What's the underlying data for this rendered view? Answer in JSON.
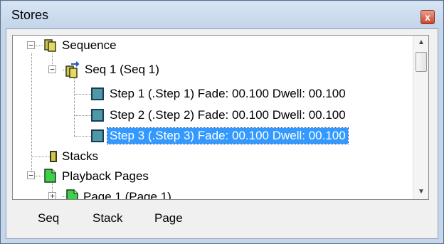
{
  "window": {
    "title": "Stores",
    "close_glyph": "x"
  },
  "tree": {
    "nodes": [
      {
        "label": "Sequence",
        "icon": "sequence-folder-icon"
      },
      {
        "label": "Seq 1 (Seq 1)",
        "icon": "sequence-item-icon"
      },
      {
        "label": "Step 1 (.Step 1) Fade: 00.100 Dwell: 00.100",
        "icon": "step-icon"
      },
      {
        "label": "Step 2 (.Step 2) Fade: 00.100 Dwell: 00.100",
        "icon": "step-icon"
      },
      {
        "label": "Step 3 (.Step 3) Fade: 00.100 Dwell: 00.100",
        "icon": "step-icon",
        "selected": true
      },
      {
        "label": "Stacks",
        "icon": "stacks-icon"
      },
      {
        "label": "Playback Pages",
        "icon": "page-icon"
      },
      {
        "label": "Page 1 (Page 1)",
        "icon": "page-icon"
      }
    ],
    "expander_collapse": "−",
    "expander_expand": "+"
  },
  "scrollbar": {
    "up_glyph": "▲",
    "down_glyph": "▼"
  },
  "buttons": {
    "seq": "Seq",
    "stack": "Stack",
    "page": "Page"
  },
  "colors": {
    "selection": "#3399ff",
    "titlebar": "#c5d6ea",
    "close": "#c9472c"
  }
}
